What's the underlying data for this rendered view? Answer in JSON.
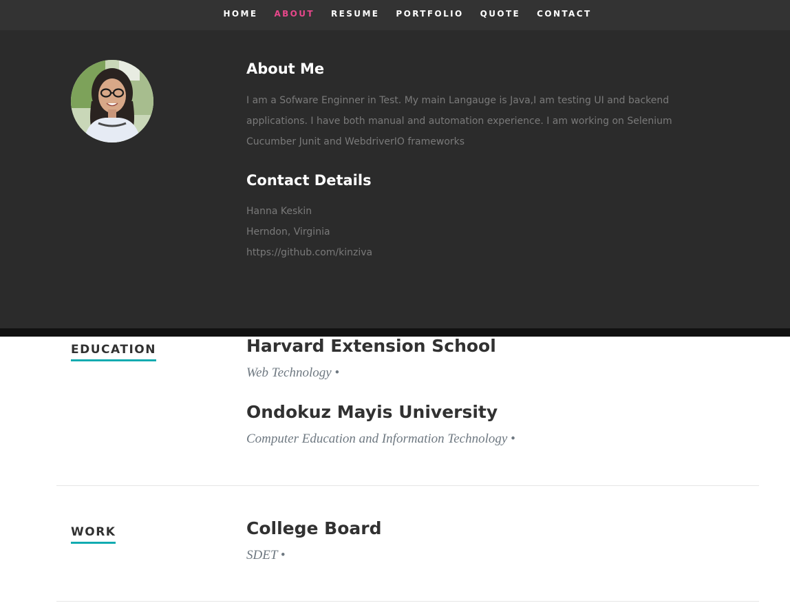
{
  "nav": {
    "items": [
      "HOME",
      "ABOUT",
      "RESUME",
      "PORTFOLIO",
      "QUOTE",
      "CONTACT"
    ],
    "active": "ABOUT"
  },
  "about": {
    "heading": "About Me",
    "text": "I am a Sofware Enginner in Test. My main Langauge is Java,I am testing UI and backend applications. I have both manual and automation experience. I am working on Selenium Cucumber Junit and WebdriverIO frameworks",
    "contact_heading": "Contact Details",
    "contact": {
      "name": "Hanna Keskin",
      "location": "Herndon, Virginia",
      "github": "https://github.com/kinziva"
    }
  },
  "education": {
    "label": "EDUCATION",
    "items": [
      {
        "school": "Harvard Extension School",
        "info": "Web Technology •"
      },
      {
        "school": "Ondokuz Mayis University",
        "info": "Computer Education and Information Technology •"
      }
    ]
  },
  "work": {
    "label": "WORK",
    "items": [
      {
        "company": "College Board",
        "info": "SDET •"
      }
    ]
  },
  "colors": {
    "accent_active": "#e8478b",
    "section_underline": "#11abb0",
    "dark_bg": "#2b2b2b",
    "nav_bg": "#333333"
  }
}
